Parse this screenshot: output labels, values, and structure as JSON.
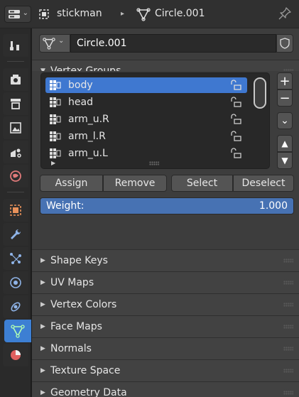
{
  "header": {
    "object_name": "stickman",
    "mesh_name": "Circle.001",
    "separator": "▸"
  },
  "data_block": {
    "name": "Circle.001"
  },
  "vertex_groups": {
    "title": "Vertex Groups",
    "items": [
      {
        "label": "body",
        "selected": true
      },
      {
        "label": "head"
      },
      {
        "label": "arm_u.R"
      },
      {
        "label": "arm_l.R"
      },
      {
        "label": "arm_u.L"
      }
    ],
    "side_buttons": {
      "add": "+",
      "remove": "−",
      "specials": "⌄",
      "move_up": "▲",
      "move_down": "▼"
    },
    "assign_label": "Assign",
    "remove_label": "Remove",
    "select_label": "Select",
    "deselect_label": "Deselect",
    "weight_label": "Weight:",
    "weight_value": "1.000"
  },
  "collapsed_panels": [
    "Shape Keys",
    "UV Maps",
    "Vertex Colors",
    "Face Maps",
    "Normals",
    "Texture Space",
    "Geometry Data"
  ],
  "colors": {
    "accent": "#4772b3",
    "selected_row": "#3f78d0",
    "active_tab": "#3d7fd3"
  },
  "icons": {
    "editor_type": "properties-editor-icon",
    "object": "object-icon",
    "mesh_data": "mesh-data-icon",
    "pin": "pin-icon",
    "fake_user": "shield-icon",
    "group": "vertex-group-icon",
    "lock": "lock-open-icon"
  },
  "tabs": [
    "tool-tab",
    "render-tab",
    "output-tab",
    "view-layer-tab",
    "scene-tab",
    "world-tab",
    "object-tab",
    "modifiers-tab",
    "particles-tab",
    "physics-tab",
    "constraints-tab",
    "data-tab",
    "material-tab"
  ]
}
